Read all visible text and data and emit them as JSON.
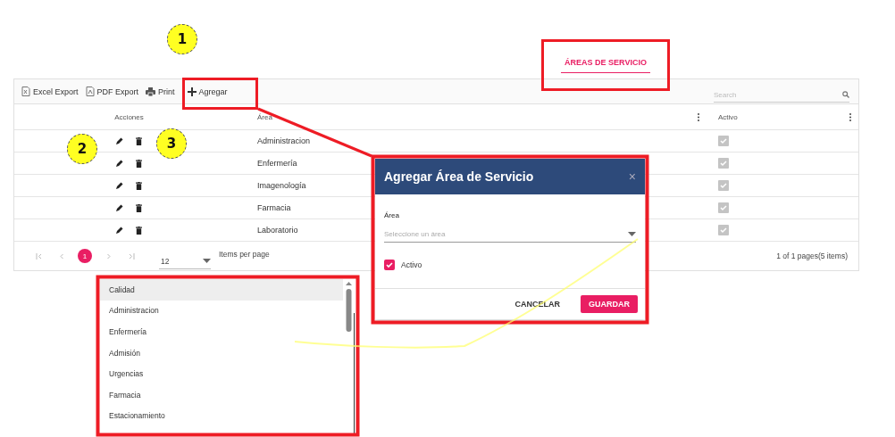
{
  "tab": {
    "label": "ÁREAS DE SERVICIO",
    "selected": true
  },
  "toolbar": [
    {
      "label": "Excel Export",
      "kind": "excel"
    },
    {
      "label": "PDF Export",
      "kind": "pdf"
    },
    {
      "label": "Print",
      "kind": "print"
    },
    {
      "label": "Agregar",
      "kind": "add"
    }
  ],
  "search": {
    "placeholder": "Search"
  },
  "columns": [
    "Acciones",
    "Área",
    "Activo"
  ],
  "rows": [
    {
      "area": "Administracion",
      "activo": true
    },
    {
      "area": "Enfermería",
      "activo": true
    },
    {
      "area": "Imagenología",
      "activo": true
    },
    {
      "area": "Farmacia",
      "activo": true
    },
    {
      "area": "Laboratorio",
      "activo": true
    }
  ],
  "pager": {
    "pages": [
      {
        "label": "1",
        "selected": true
      }
    ],
    "page_size": "12",
    "page_size_label": "Items per page",
    "summary": "1 of 1 pages(5 items)"
  },
  "dialog": {
    "title": "Agregar Área de Servicio",
    "close": "×",
    "field_label": "Área",
    "placeholder": "Seleccione un área",
    "checkbox": {
      "label": "Activo",
      "checked": true
    },
    "buttons": [
      {
        "label": "CANCELAR",
        "kind": "flat"
      },
      {
        "label": "GUARDAR",
        "kind": "primary"
      }
    ]
  },
  "dropdown": {
    "options": [
      {
        "label": "Calidad",
        "selected": true
      },
      {
        "label": "Administracion",
        "selected": false
      },
      {
        "label": "Enfermería",
        "selected": false
      },
      {
        "label": "Admisión",
        "selected": false
      },
      {
        "label": "Urgencias",
        "selected": false
      },
      {
        "label": "Farmacia",
        "selected": false
      },
      {
        "label": "Estacionamiento",
        "selected": false
      }
    ]
  },
  "markers": [
    "1",
    "2",
    "3"
  ]
}
